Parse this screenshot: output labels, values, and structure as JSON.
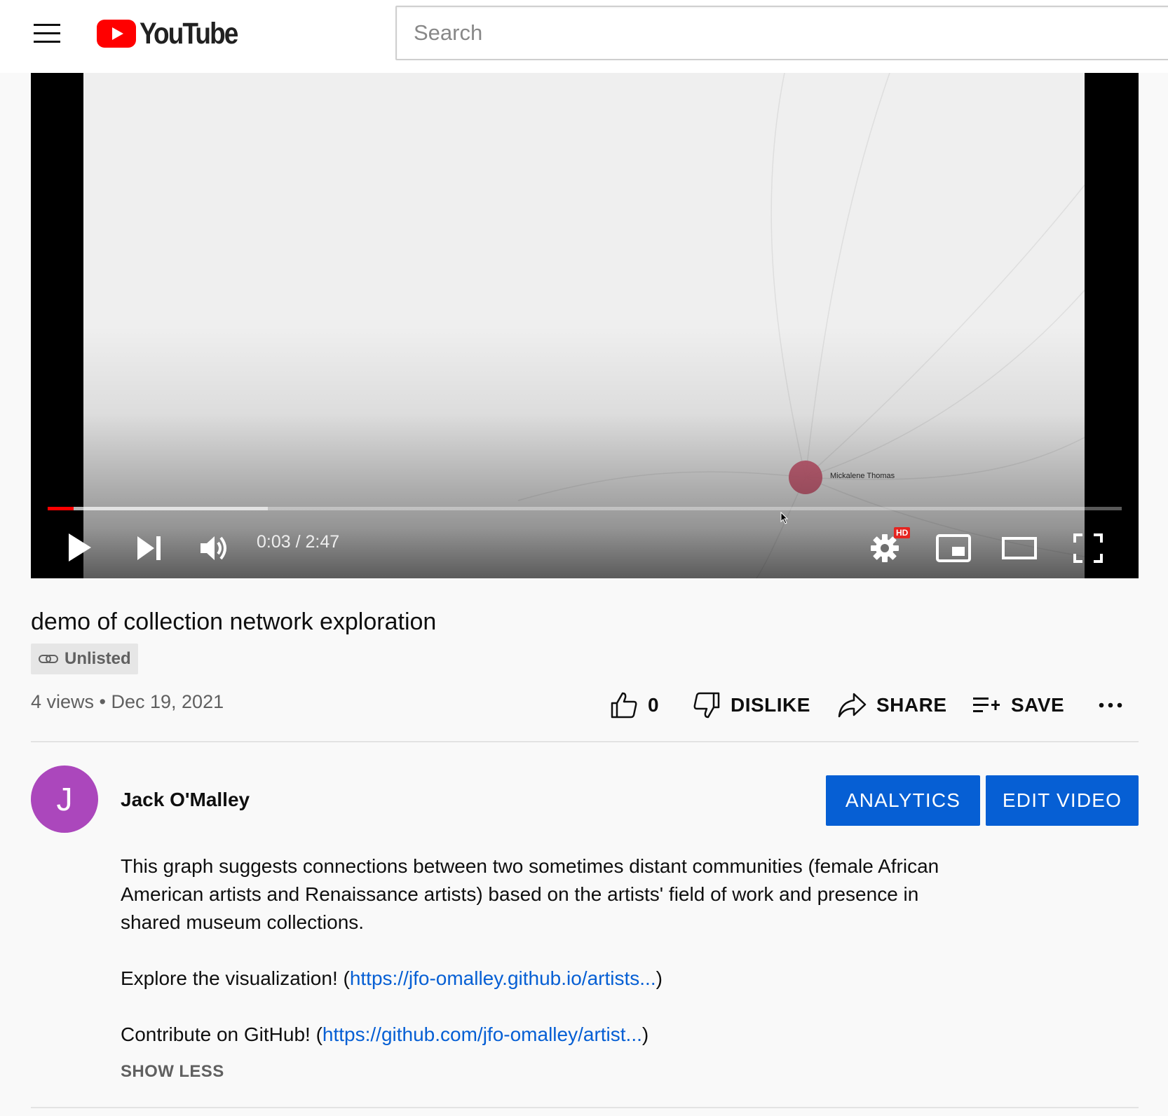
{
  "header": {
    "logo_text": "YouTube",
    "search": {
      "placeholder": "Search",
      "value": ""
    }
  },
  "player": {
    "overlay_label": "Mickalene Thomas",
    "time_current": "0:03",
    "time_total": "2:47",
    "time_display": "0:03 / 2:47",
    "played_fraction": 0.024,
    "buffered_fraction": 0.205,
    "quality_badge": "HD",
    "icons": {
      "play": "play-icon",
      "next": "skip-next-icon",
      "volume": "volume-icon",
      "settings": "settings-gear-icon",
      "miniplayer": "miniplayer-icon",
      "theater": "theater-mode-icon",
      "fullscreen": "fullscreen-icon"
    }
  },
  "video": {
    "title": "demo of collection network exploration",
    "privacy": "Unlisted",
    "views": "4 views",
    "date": "Dec 19, 2021",
    "meta_line": "4 views • Dec 19, 2021"
  },
  "actions": {
    "like_count": "0",
    "dislike_label": "DISLIKE",
    "share_label": "SHARE",
    "save_label": "SAVE"
  },
  "owner": {
    "avatar_letter": "J",
    "avatar_color": "#ab47bc",
    "channel_name": "Jack O'Malley",
    "analytics_label": "ANALYTICS",
    "edit_label": "EDIT VIDEO"
  },
  "description": {
    "para1": "This graph suggests connections between two sometimes distant communities (female African American artists and Renaissance artists) based on the artists' field of work and presence in shared museum collections.",
    "explore_prefix": "Explore the visualization! (",
    "explore_link": "https://jfo-omalley.github.io/artists...",
    "explore_suffix": ")",
    "github_prefix": "Contribute on GitHub! (",
    "github_link": "https://github.com/jfo-omalley/artist...",
    "github_suffix": ")",
    "show_less": "SHOW LESS"
  },
  "colors": {
    "brand_red": "#ff0000",
    "accent_blue": "#065fd4",
    "progress_red": "#ff0000",
    "node_pink": "#d36079"
  }
}
